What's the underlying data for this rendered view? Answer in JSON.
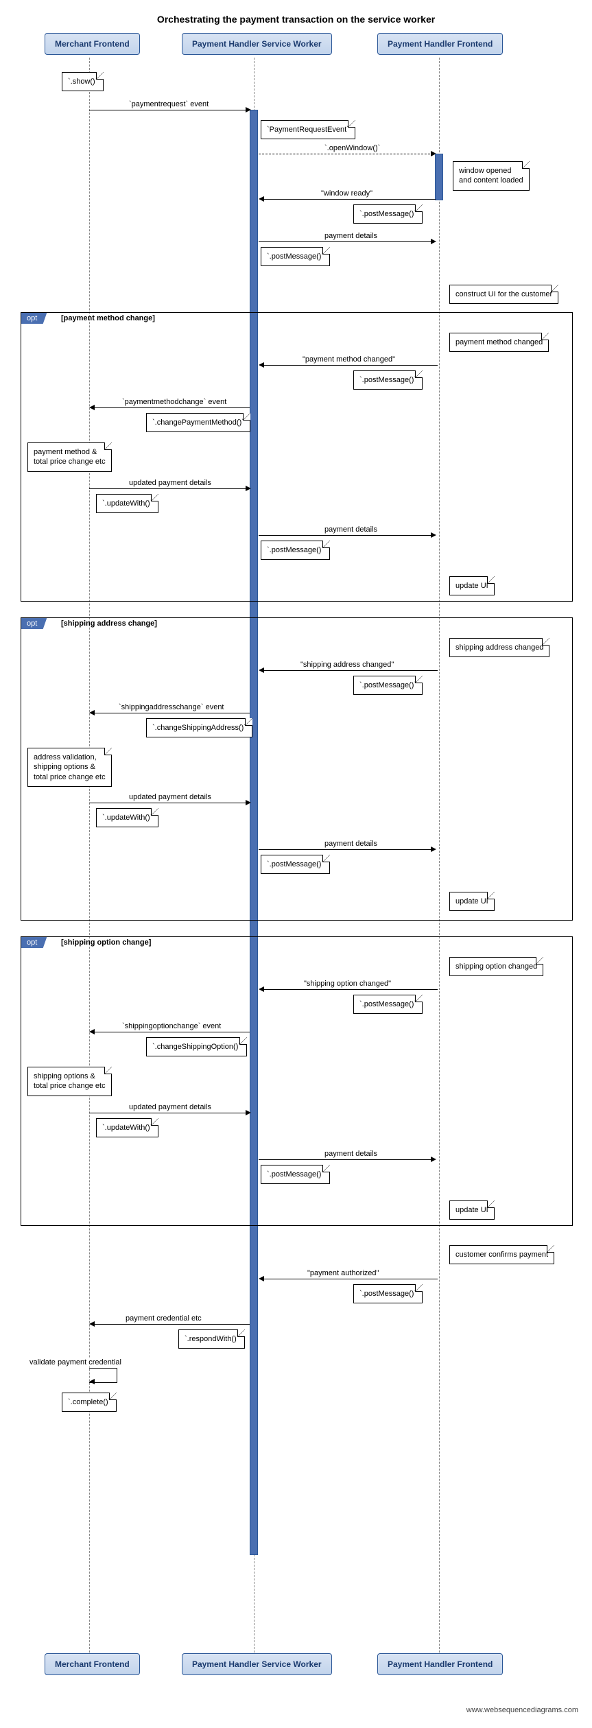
{
  "title": "Orchestrating the payment transaction on the service worker",
  "participants": {
    "merchant": "Merchant Frontend",
    "sw": "Payment Handler Service Worker",
    "ph": "Payment Handler Frontend"
  },
  "notes": {
    "show": "`.show()`",
    "payReqEvt": "`PaymentRequestEvent`",
    "openWindow": "`.openWindow()`",
    "windowOpened": "window opened\nand content loaded",
    "postMessage": "`.postMessage()`",
    "constructUI": "construct UI for the customer",
    "pmChanged": "payment method changed",
    "changePM": "`.changePaymentMethod()`",
    "pmTotalChange": "payment method &\ntotal price change etc",
    "updateWith": "`.updateWith()`",
    "updateUI": "update UI",
    "saChanged": "shipping address changed",
    "changeSA": "`.changeShippingAddress()`",
    "addrValidation": "address validation,\nshipping options &\ntotal price change etc",
    "soChanged": "shipping option changed",
    "changeSO": "`.changeShippingOption()`",
    "soTotalChange": "shipping options &\ntotal price change etc",
    "custConfirms": "customer confirms payment",
    "respondWith": "`.respondWith()`",
    "validateCred": "validate payment credential",
    "complete": "`.complete()`"
  },
  "messages": {
    "paymentrequest": "`paymentrequest` event",
    "windowReady": "\"window ready\"",
    "paymentDetails": "payment details",
    "pmChangedMsg": "\"payment method changed\"",
    "pmcEvent": "`paymentmethodchange` event",
    "updatedDetails": "updated payment details",
    "saChangedMsg": "\"shipping address changed\"",
    "sacEvent": "`shippingaddresschange` event",
    "soChangedMsg": "\"shipping option changed\"",
    "socEvent": "`shippingoptionchange` event",
    "payAuth": "\"payment authorized\"",
    "payCred": "payment credential etc"
  },
  "frames": {
    "opt": "opt",
    "pmChange": "[payment method change]",
    "saChange": "[shipping address change]",
    "soChange": "[shipping option change]"
  },
  "watermark": "www.websequencediagrams.com",
  "lanes": {
    "merchant": 110,
    "sw": 350,
    "ph": 620
  },
  "chart_data": {
    "type": "sequence-diagram",
    "participants": [
      "Merchant Frontend",
      "Payment Handler Service Worker",
      "Payment Handler Frontend"
    ],
    "interactions": [
      {
        "from": "Merchant Frontend",
        "to": "Merchant Frontend",
        "kind": "note",
        "text": "`.show()`"
      },
      {
        "from": "Merchant Frontend",
        "to": "Payment Handler Service Worker",
        "kind": "msg",
        "text": "`paymentrequest` event"
      },
      {
        "from": "Payment Handler Service Worker",
        "to": "Payment Handler Service Worker",
        "kind": "note",
        "text": "`PaymentRequestEvent`"
      },
      {
        "from": "Payment Handler Service Worker",
        "to": "Payment Handler Frontend",
        "kind": "msg-dashed",
        "text": "`.openWindow()`"
      },
      {
        "from": "Payment Handler Frontend",
        "to": "Payment Handler Frontend",
        "kind": "note",
        "text": "window opened and content loaded"
      },
      {
        "from": "Payment Handler Frontend",
        "to": "Payment Handler Service Worker",
        "kind": "msg",
        "text": "\"window ready\""
      },
      {
        "from": "Payment Handler Service Worker",
        "to": "Payment Handler Service Worker",
        "kind": "note",
        "text": "`.postMessage()`"
      },
      {
        "from": "Payment Handler Service Worker",
        "to": "Payment Handler Frontend",
        "kind": "msg",
        "text": "payment details"
      },
      {
        "from": "Payment Handler Service Worker",
        "to": "Payment Handler Service Worker",
        "kind": "note",
        "text": "`.postMessage()`"
      },
      {
        "from": "Payment Handler Frontend",
        "to": "Payment Handler Frontend",
        "kind": "note",
        "text": "construct UI for the customer"
      },
      {
        "kind": "opt-begin",
        "label": "[payment method change]"
      },
      {
        "from": "Payment Handler Frontend",
        "to": "Payment Handler Frontend",
        "kind": "note",
        "text": "payment method changed"
      },
      {
        "from": "Payment Handler Frontend",
        "to": "Payment Handler Service Worker",
        "kind": "msg",
        "text": "\"payment method changed\""
      },
      {
        "from": "Payment Handler Service Worker",
        "to": "Payment Handler Service Worker",
        "kind": "note",
        "text": "`.postMessage()`"
      },
      {
        "from": "Payment Handler Service Worker",
        "to": "Merchant Frontend",
        "kind": "msg",
        "text": "`paymentmethodchange` event"
      },
      {
        "from": "Payment Handler Service Worker",
        "to": "Payment Handler Service Worker",
        "kind": "note",
        "text": "`.changePaymentMethod()`"
      },
      {
        "from": "Merchant Frontend",
        "to": "Merchant Frontend",
        "kind": "note",
        "text": "payment method & total price change etc"
      },
      {
        "from": "Merchant Frontend",
        "to": "Payment Handler Service Worker",
        "kind": "msg",
        "text": "updated payment details"
      },
      {
        "from": "Merchant Frontend",
        "to": "Merchant Frontend",
        "kind": "note",
        "text": "`.updateWith()`"
      },
      {
        "from": "Payment Handler Service Worker",
        "to": "Payment Handler Frontend",
        "kind": "msg",
        "text": "payment details"
      },
      {
        "from": "Payment Handler Service Worker",
        "to": "Payment Handler Service Worker",
        "kind": "note",
        "text": "`.postMessage()`"
      },
      {
        "from": "Payment Handler Frontend",
        "to": "Payment Handler Frontend",
        "kind": "note",
        "text": "update UI"
      },
      {
        "kind": "opt-end"
      },
      {
        "kind": "opt-begin",
        "label": "[shipping address change]"
      },
      {
        "from": "Payment Handler Frontend",
        "to": "Payment Handler Frontend",
        "kind": "note",
        "text": "shipping address changed"
      },
      {
        "from": "Payment Handler Frontend",
        "to": "Payment Handler Service Worker",
        "kind": "msg",
        "text": "\"shipping address changed\""
      },
      {
        "from": "Payment Handler Service Worker",
        "to": "Payment Handler Service Worker",
        "kind": "note",
        "text": "`.postMessage()`"
      },
      {
        "from": "Payment Handler Service Worker",
        "to": "Merchant Frontend",
        "kind": "msg",
        "text": "`shippingaddresschange` event"
      },
      {
        "from": "Payment Handler Service Worker",
        "to": "Payment Handler Service Worker",
        "kind": "note",
        "text": "`.changeShippingAddress()`"
      },
      {
        "from": "Merchant Frontend",
        "to": "Merchant Frontend",
        "kind": "note",
        "text": "address validation, shipping options & total price change etc"
      },
      {
        "from": "Merchant Frontend",
        "to": "Payment Handler Service Worker",
        "kind": "msg",
        "text": "updated payment details"
      },
      {
        "from": "Merchant Frontend",
        "to": "Merchant Frontend",
        "kind": "note",
        "text": "`.updateWith()`"
      },
      {
        "from": "Payment Handler Service Worker",
        "to": "Payment Handler Frontend",
        "kind": "msg",
        "text": "payment details"
      },
      {
        "from": "Payment Handler Service Worker",
        "to": "Payment Handler Service Worker",
        "kind": "note",
        "text": "`.postMessage()`"
      },
      {
        "from": "Payment Handler Frontend",
        "to": "Payment Handler Frontend",
        "kind": "note",
        "text": "update UI"
      },
      {
        "kind": "opt-end"
      },
      {
        "kind": "opt-begin",
        "label": "[shipping option change]"
      },
      {
        "from": "Payment Handler Frontend",
        "to": "Payment Handler Frontend",
        "kind": "note",
        "text": "shipping option changed"
      },
      {
        "from": "Payment Handler Frontend",
        "to": "Payment Handler Service Worker",
        "kind": "msg",
        "text": "\"shipping option changed\""
      },
      {
        "from": "Payment Handler Service Worker",
        "to": "Payment Handler Service Worker",
        "kind": "note",
        "text": "`.postMessage()`"
      },
      {
        "from": "Payment Handler Service Worker",
        "to": "Merchant Frontend",
        "kind": "msg",
        "text": "`shippingoptionchange` event"
      },
      {
        "from": "Payment Handler Service Worker",
        "to": "Payment Handler Service Worker",
        "kind": "note",
        "text": "`.changeShippingOption()`"
      },
      {
        "from": "Merchant Frontend",
        "to": "Merchant Frontend",
        "kind": "note",
        "text": "shipping options & total price change etc"
      },
      {
        "from": "Merchant Frontend",
        "to": "Payment Handler Service Worker",
        "kind": "msg",
        "text": "updated payment details"
      },
      {
        "from": "Merchant Frontend",
        "to": "Merchant Frontend",
        "kind": "note",
        "text": "`.updateWith()`"
      },
      {
        "from": "Payment Handler Service Worker",
        "to": "Payment Handler Frontend",
        "kind": "msg",
        "text": "payment details"
      },
      {
        "from": "Payment Handler Service Worker",
        "to": "Payment Handler Service Worker",
        "kind": "note",
        "text": "`.postMessage()`"
      },
      {
        "from": "Payment Handler Frontend",
        "to": "Payment Handler Frontend",
        "kind": "note",
        "text": "update UI"
      },
      {
        "kind": "opt-end"
      },
      {
        "from": "Payment Handler Frontend",
        "to": "Payment Handler Frontend",
        "kind": "note",
        "text": "customer confirms payment"
      },
      {
        "from": "Payment Handler Frontend",
        "to": "Payment Handler Service Worker",
        "kind": "msg",
        "text": "\"payment authorized\""
      },
      {
        "from": "Payment Handler Service Worker",
        "to": "Payment Handler Service Worker",
        "kind": "note",
        "text": "`.postMessage()`"
      },
      {
        "from": "Payment Handler Service Worker",
        "to": "Merchant Frontend",
        "kind": "msg",
        "text": "payment credential etc"
      },
      {
        "from": "Payment Handler Service Worker",
        "to": "Payment Handler Service Worker",
        "kind": "note",
        "text": "`.respondWith()`"
      },
      {
        "from": "Merchant Frontend",
        "to": "Merchant Frontend",
        "kind": "self-msg",
        "text": "validate payment credential"
      },
      {
        "from": "Merchant Frontend",
        "to": "Merchant Frontend",
        "kind": "note",
        "text": "`.complete()`"
      }
    ]
  }
}
